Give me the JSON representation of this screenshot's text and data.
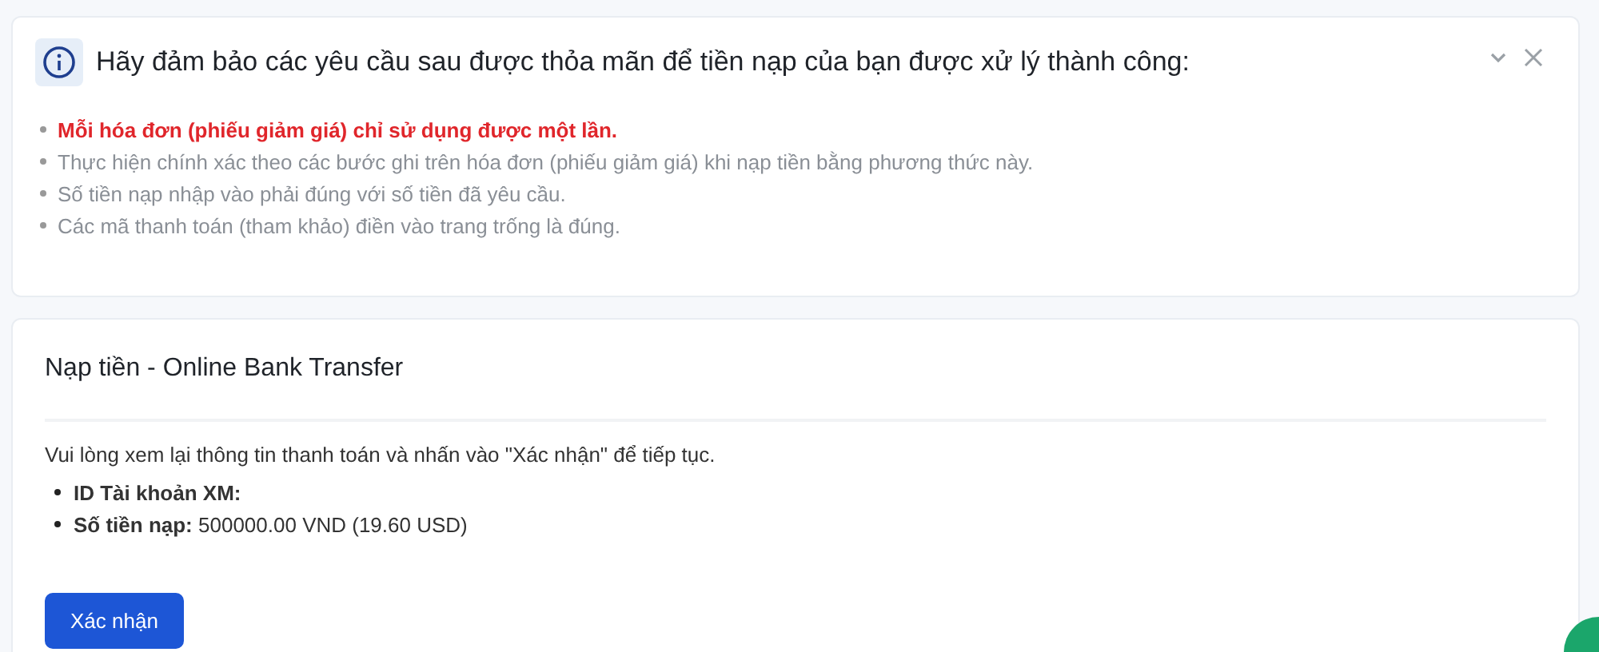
{
  "notice": {
    "title": "Hãy đảm bảo các yêu cầu sau được thỏa mãn để tiền nạp của bạn được xử lý thành công:",
    "expanded": true,
    "items": [
      {
        "kind": "warning",
        "text": "Mỗi hóa đơn (phiếu giảm giá) chỉ sử dụng được một lần."
      },
      {
        "kind": "normal",
        "text": "Thực hiện chính xác theo các bước ghi trên hóa đơn (phiếu giảm giá) khi nạp tiền bằng phương thức này."
      },
      {
        "kind": "normal",
        "text": "Số tiền nạp nhập vào phải đúng với số tiền đã yêu cầu."
      },
      {
        "kind": "normal",
        "text": "Các mã thanh toán (tham khảo) điền vào trang trống là đúng."
      }
    ]
  },
  "deposit": {
    "title": "Nạp tiền - Online Bank Transfer",
    "instruction": "Vui lòng xem lại thông tin thanh toán và nhấn vào \"Xác nhận\" để tiếp tục.",
    "details": [
      {
        "text": "**ID Tài khoản XM:**"
      },
      {
        "text": "**Số tiền nạp:** 500000.00 VND (19.60 USD)"
      }
    ],
    "confirm_button": "Xác nhận"
  }
}
